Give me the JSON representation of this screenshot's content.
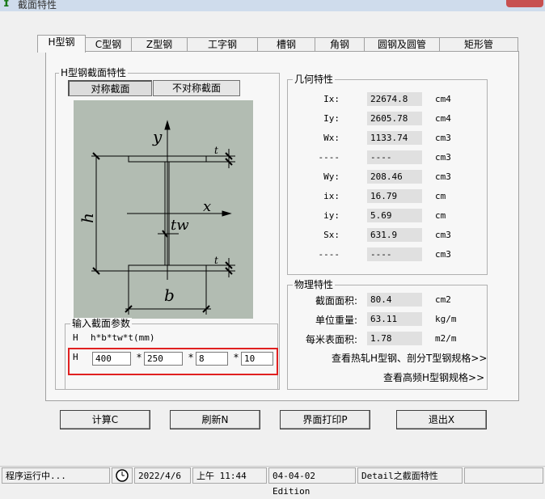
{
  "window": {
    "title": "截面特性"
  },
  "tabs": [
    {
      "label": "H型钢",
      "active": true
    },
    {
      "label": "C型钢"
    },
    {
      "label": "Z型钢"
    },
    {
      "label": "工字钢"
    },
    {
      "label": "槽钢"
    },
    {
      "label": "角钢"
    },
    {
      "label": "圆钢及圆管"
    },
    {
      "label": "矩形管"
    }
  ],
  "section_group": {
    "title": "H型钢截面特性",
    "sym_button": "对称截面",
    "asym_button": "不对称截面",
    "diagram_labels": {
      "y": "y",
      "x": "x",
      "h": "h",
      "b": "b",
      "tw": "tw",
      "t_top": "t",
      "t_bottom": "t"
    }
  },
  "geometry": {
    "title": "几何特性",
    "rows": [
      {
        "label": "Ix:",
        "value": "22674.8",
        "unit": "cm4"
      },
      {
        "label": "Iy:",
        "value": "2605.78",
        "unit": "cm4"
      },
      {
        "label": "Wx:",
        "value": "1133.74",
        "unit": "cm3"
      },
      {
        "label": "----",
        "value": "----",
        "unit": "cm3"
      },
      {
        "label": "Wy:",
        "value": "208.46",
        "unit": "cm3"
      },
      {
        "label": "ix:",
        "value": "16.79",
        "unit": "cm"
      },
      {
        "label": "iy:",
        "value": "5.69",
        "unit": "cm"
      },
      {
        "label": "Sx:",
        "value": "631.9",
        "unit": "cm3"
      },
      {
        "label": "----",
        "value": "----",
        "unit": "cm3"
      }
    ]
  },
  "physical": {
    "title": "物理特性",
    "rows": [
      {
        "label": "截面面积:",
        "value": "80.4",
        "unit": "cm2"
      },
      {
        "label": "单位重量:",
        "value": "63.11",
        "unit": "kg/m"
      },
      {
        "label": "每米表面积:",
        "value": "1.78",
        "unit": "m2/m"
      }
    ],
    "link1": "查看热轧H型钢、剖分T型钢规格>>",
    "link2": "查看高频H型钢规格>>"
  },
  "input_group": {
    "title": "输入截面参数",
    "hint_label": "H",
    "hint_format": "h*b*tw*t(mm)",
    "row_label": "H",
    "values": [
      "400",
      "250",
      "8",
      "10"
    ],
    "separator": "*"
  },
  "buttons": {
    "calc": "计算C",
    "refresh": "刷新N",
    "print": "界面打印P",
    "exit": "退出X"
  },
  "status": {
    "running": "程序运行中...",
    "date": "2022/4/6",
    "time": "上午 11:44",
    "version": "04-04-02 Edition",
    "detail": "Detail之截面特性"
  },
  "colors": {
    "highlight_box": "#e02020",
    "diagram_bg": "#b2bcb2"
  }
}
